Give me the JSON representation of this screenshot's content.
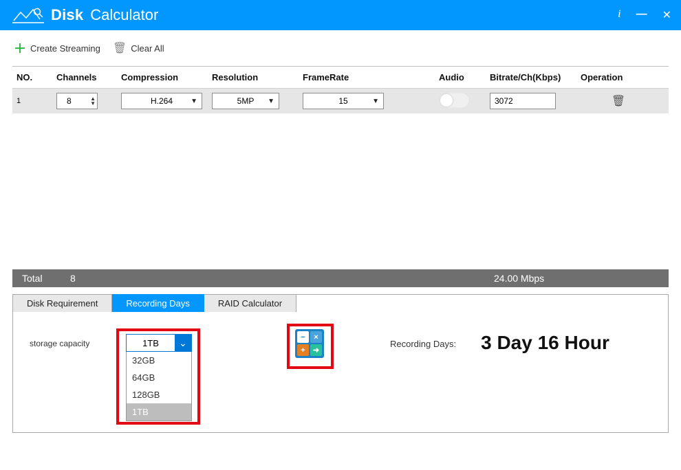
{
  "window": {
    "title_bold": "Disk",
    "title_light": "Calculator"
  },
  "toolbar": {
    "create_label": "Create Streaming",
    "clear_label": "Clear All"
  },
  "table": {
    "headers": {
      "no": "NO.",
      "channels": "Channels",
      "compression": "Compression",
      "resolution": "Resolution",
      "framerate": "FrameRate",
      "audio": "Audio",
      "bitrate": "Bitrate/Ch(Kbps)",
      "operation": "Operation"
    },
    "row": {
      "no": "1",
      "channels": "8",
      "compression": "H.264",
      "resolution": "5MP",
      "framerate": "15",
      "bitrate": "3072",
      "audio_on": false
    }
  },
  "total": {
    "label": "Total",
    "channels": "8",
    "bitrate": "24.00 Mbps"
  },
  "tabs": {
    "t1": "Disk Requirement",
    "t2": "Recording Days",
    "t3": "RAID Calculator",
    "active": "t2"
  },
  "panel": {
    "capacity_label": "storage capacity",
    "capacity_value": "1TB",
    "capacity_options": [
      "32GB",
      "64GB",
      "128GB",
      "1TB"
    ],
    "result_label": "Recording Days:",
    "result_value": "3 Day 16 Hour"
  }
}
